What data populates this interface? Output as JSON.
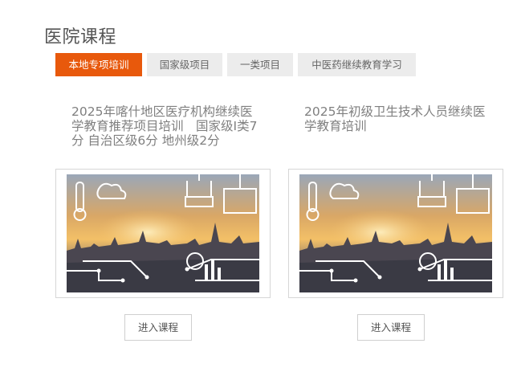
{
  "page": {
    "title": "医院课程"
  },
  "tabs": [
    {
      "label": "本地专项培训",
      "active": true
    },
    {
      "label": "国家级项目",
      "active": false
    },
    {
      "label": "一类项目",
      "active": false
    },
    {
      "label": "中医药继续教育学习",
      "active": false
    }
  ],
  "courses": [
    {
      "title": "2025年喀什地区医疗机构继续医学教育推荐项目培训　国家级I类7分 自治区级6分 地州级2分",
      "thumbnail_icon": "city-skyline-infographic-image",
      "button_label": "进入课程"
    },
    {
      "title": "2025年初级卫生技术人员继续医学教育培训",
      "thumbnail_icon": "city-skyline-infographic-image",
      "button_label": "进入课程"
    }
  ],
  "colors": {
    "accent": "#e8590c",
    "tab_bg": "#ececec"
  }
}
